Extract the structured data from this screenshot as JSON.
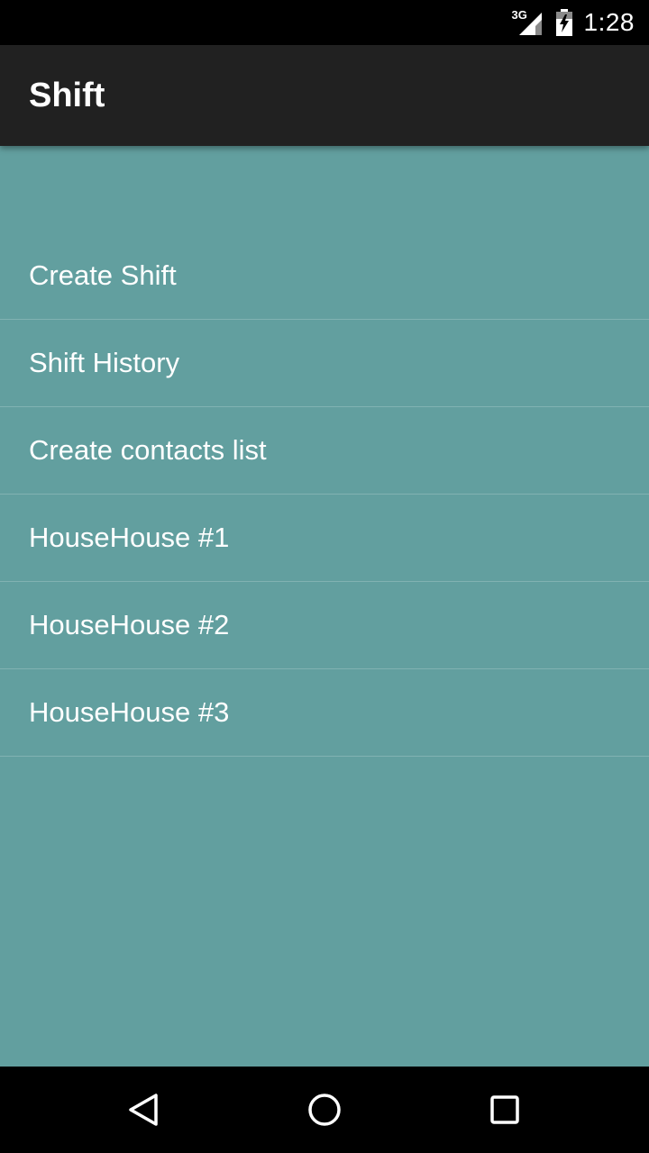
{
  "status_bar": {
    "network_type": "3G",
    "time": "1:28",
    "icons": {
      "signal": "cell-signal-icon",
      "battery": "battery-charging-icon"
    }
  },
  "app_bar": {
    "title": "Shift"
  },
  "menu": {
    "items": [
      {
        "label": "Create Shift"
      },
      {
        "label": "Shift History"
      },
      {
        "label": "Create contacts list"
      },
      {
        "label": "HouseHouse #1"
      },
      {
        "label": "HouseHouse #2"
      },
      {
        "label": "HouseHouse #3"
      }
    ]
  },
  "nav_bar": {
    "icons": [
      "back-icon",
      "home-icon",
      "recents-icon"
    ]
  },
  "colors": {
    "background": "#629f9f",
    "app_bar": "#212121",
    "status_bar": "#000000",
    "text": "#ffffff"
  }
}
